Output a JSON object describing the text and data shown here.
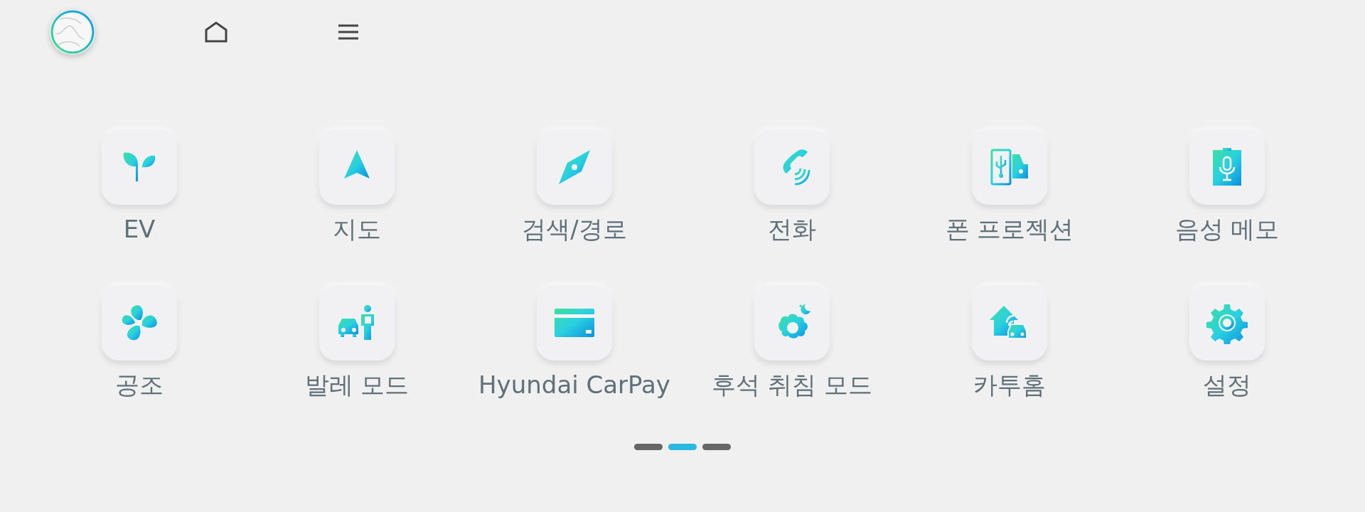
{
  "top_bar": {
    "items": [
      {
        "kind": "profile"
      },
      {
        "kind": "home"
      },
      {
        "kind": "menu"
      }
    ]
  },
  "apps": [
    {
      "label": "EV",
      "kind": "ev"
    },
    {
      "label": "지도",
      "kind": "map"
    },
    {
      "label": "검색/경로",
      "kind": "compass"
    },
    {
      "label": "전화",
      "kind": "phone"
    },
    {
      "label": "폰 프로젝션",
      "kind": "projection"
    },
    {
      "label": "음성 메모",
      "kind": "voice"
    },
    {
      "label": "공조",
      "kind": "fan"
    },
    {
      "label": "발레 모드",
      "kind": "valet"
    },
    {
      "label": "Hyundai CarPay",
      "kind": "card"
    },
    {
      "label": "후석 취침 모드",
      "kind": "sleep"
    },
    {
      "label": "카투홈",
      "kind": "cartohome"
    },
    {
      "label": "설정",
      "kind": "settings"
    }
  ],
  "pages": [
    {
      "selected": false
    },
    {
      "selected": true
    },
    {
      "selected": false
    }
  ]
}
